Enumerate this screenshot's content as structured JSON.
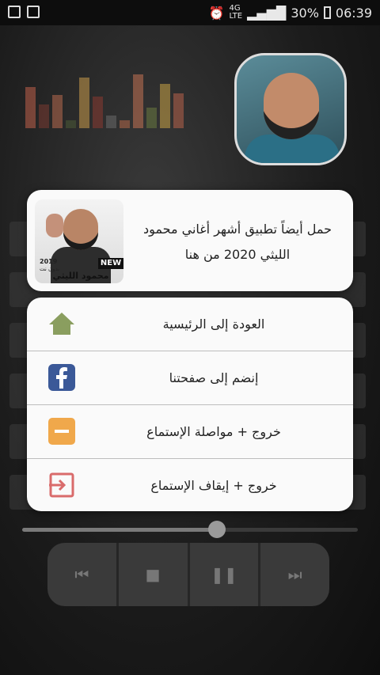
{
  "status_bar": {
    "time": "06:39",
    "battery": "30%",
    "network": "4G",
    "network_sub": "LTE",
    "icons": [
      "gallery-icon",
      "notification-icon",
      "alarm-icon",
      "signal-icon",
      "battery-icon"
    ]
  },
  "promo": {
    "text": "حمل أيضاً تطبيق أشهر أغاني محمود الليثي 2020 من هنا",
    "thumb_badge": "NEW",
    "thumb_year": "2019",
    "thumb_sub": "بدون نت",
    "thumb_name": "محمود الليثي"
  },
  "menu": {
    "items": [
      {
        "label": "العودة إلى الرئيسية",
        "icon": "home-icon",
        "color": "#8a9e5f"
      },
      {
        "label": "إنضم إلى صفحتنا",
        "icon": "facebook-icon",
        "color": "#3b5998"
      },
      {
        "label": "خروج + مواصلة الإستماع",
        "icon": "minimize-icon",
        "color": "#f0a84b"
      },
      {
        "label": "خروج + إيقاف الإستماع",
        "icon": "exit-icon",
        "color": "#d96b6b"
      }
    ]
  },
  "player": {
    "progress": 0.58,
    "buttons": [
      "previous-icon",
      "stop-icon",
      "pause-icon",
      "next-icon"
    ]
  },
  "colors": {
    "eq_bars": [
      "#c0614a",
      "#7a3b32",
      "#b8694e",
      "#4a5a36",
      "#c89a4a",
      "#8a3b32",
      "#6a6a6a",
      "#b36849",
      "#c57253",
      "#6a7a40",
      "#c9a245",
      "#b8634a"
    ]
  }
}
